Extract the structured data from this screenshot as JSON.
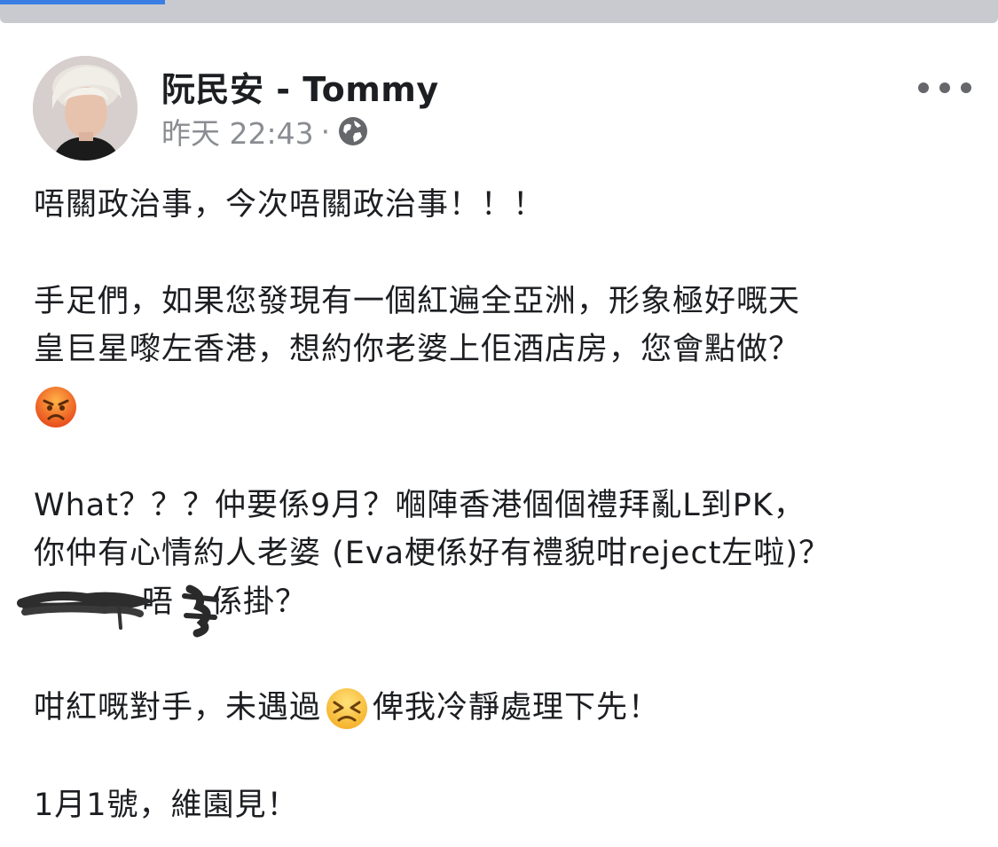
{
  "post": {
    "author": "阮民安 - Tommy",
    "time": "昨天 22:43",
    "separator": "·",
    "privacy_icon": "globe-icon",
    "lines": {
      "l1": "唔關政治事，今次唔關政治事！！！",
      "l2": "手足們，如果您發現有一個紅遍全亞洲，形象極好嘅天",
      "l3": "皇巨星嚟左香港，想約你老婆上佢酒店房，您會點做？",
      "l4_emoji": "angry-face",
      "l5": "What？？？仲要係9月？嗰陣香港個個禮拜亂L到PK，",
      "l6": "你仲有心情約人老婆 (Eva梗係好有禮貌咁reject左啦)？",
      "l7": "唔",
      "l7b": "係掛？",
      "l8a": "咁紅嘅對手，未遇過",
      "l8_emoji": "persevering-face",
      "l8b": "俾我冷靜處理下先！",
      "l9": "1月1號，維園見！"
    },
    "more_icon": "more-options-icon"
  }
}
